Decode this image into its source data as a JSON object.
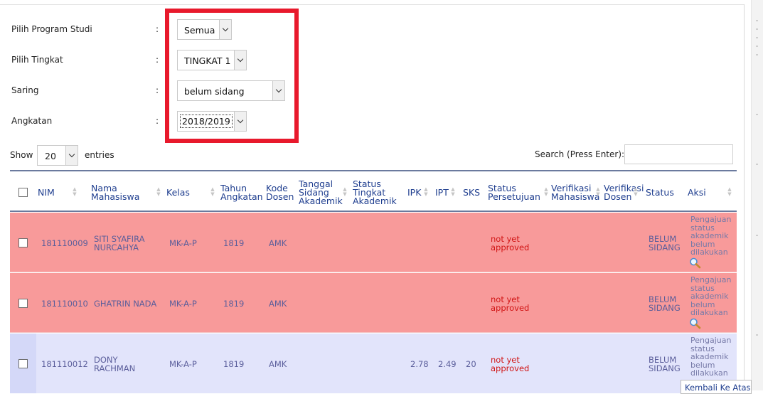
{
  "filters": {
    "program_studi": {
      "label": "Pilih Program Studi",
      "value": "Semua"
    },
    "tingkat": {
      "label": "Pilih Tingkat",
      "value": "TINGKAT 1"
    },
    "saring": {
      "label": "Saring",
      "value": "belum sidang"
    },
    "angkatan": {
      "label": "Angkatan",
      "value": "2018/2019"
    },
    "colon": ":"
  },
  "datatable": {
    "show_label": "Show",
    "length_value": "20",
    "entries_label": "entries",
    "search_label": "Search (Press Enter):",
    "search_value": ""
  },
  "table": {
    "headers": {
      "nim": "NIM",
      "nama": [
        "Nama",
        "Mahasiswa"
      ],
      "kelas": "Kelas",
      "tahun": [
        "Tahun",
        "Angkatan"
      ],
      "kode": [
        "Kode",
        "Dosen"
      ],
      "tanggal": [
        "Tanggal",
        "Sidang",
        "Akademik"
      ],
      "status_tingkat": [
        "Status",
        "Tingkat",
        "Akademik"
      ],
      "ipk": "IPK",
      "ipt": "IPT",
      "sks": "SKS",
      "status_persetujuan": [
        "Status",
        "Persetujuan"
      ],
      "verif_mhs": [
        "Verifikasi",
        "Mahasiswa"
      ],
      "verif_dosen": [
        "Verifikasi",
        "Dosen"
      ],
      "status": "Status",
      "aksi": "Aksi"
    },
    "rows": [
      {
        "nim": "181110009",
        "nama": [
          "SITI SYAFIRA",
          "NURCAHYA"
        ],
        "kelas": "MK-A-P",
        "tahun": "1819",
        "kode": "AMK",
        "ipk": "",
        "ipt": "",
        "sks": "",
        "persetujuan": [
          "not yet",
          "approved"
        ],
        "status": [
          "BELUM",
          "SIDANG"
        ],
        "aksi": [
          "Pengajuan",
          "status",
          "akademik",
          "belum",
          "dilakukan"
        ],
        "highlight": "#f89a9a"
      },
      {
        "nim": "181110010",
        "nama": [
          "GHATRIN NADA",
          ""
        ],
        "kelas": "MK-A-P",
        "tahun": "1819",
        "kode": "AMK",
        "ipk": "",
        "ipt": "",
        "sks": "",
        "persetujuan": [
          "not yet",
          "approved"
        ],
        "status": [
          "BELUM",
          "SIDANG"
        ],
        "aksi": [
          "Pengajuan",
          "status",
          "akademik",
          "belum",
          "dilakukan"
        ],
        "highlight": "#f89a9a"
      },
      {
        "nim": "181110012",
        "nama": [
          "DONY",
          "RACHMAN"
        ],
        "kelas": "MK-A-P",
        "tahun": "1819",
        "kode": "AMK",
        "ipk": "2.78",
        "ipt": "2.49",
        "sks": "20",
        "persetujuan": [
          "not yet",
          "approved"
        ],
        "status": [
          "BELUM",
          "SIDANG"
        ],
        "aksi": [
          "Pengajuan",
          "status",
          "akademik",
          "belum",
          "dilakukan"
        ],
        "highlight": "#e2e4fb"
      }
    ]
  },
  "back_to_top": "Kembali Ke Atas",
  "colors": {
    "header_text": "#1f3e8f",
    "row_unapproved": "#f89a9a",
    "row_normal": "#e2e4fb",
    "status_text": "#d11414",
    "callout": "#e8192c"
  },
  "icons": {
    "dropdown": "chevron-down-icon",
    "action": "magnifier-icon"
  }
}
